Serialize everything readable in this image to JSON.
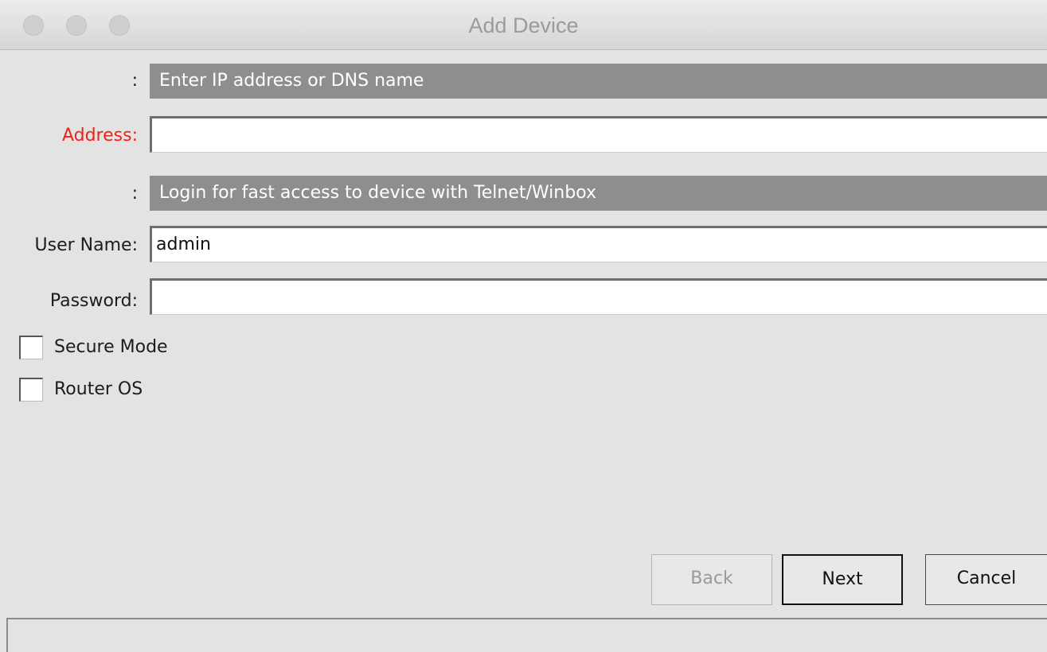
{
  "window": {
    "title": "Add Device"
  },
  "sections": {
    "address_banner_prefix": ":",
    "address_banner": "Enter IP address or DNS name",
    "login_banner_prefix": ":",
    "login_banner": "Login for fast access to device with Telnet/Winbox"
  },
  "fields": {
    "address_label": "Address:",
    "address_value": "",
    "username_label": "User Name:",
    "username_value": "admin",
    "password_label": "Password:",
    "password_value": ""
  },
  "checkboxes": {
    "secure_mode_label": "Secure Mode",
    "secure_mode_checked": false,
    "router_os_label": "Router OS",
    "router_os_checked": false
  },
  "buttons": {
    "back": "Back",
    "back_enabled": false,
    "next": "Next",
    "cancel": "Cancel"
  },
  "statusbar": {
    "text": ""
  },
  "colors": {
    "required_label": "#e8251b",
    "banner_bg": "#8e8e8e",
    "window_bg": "#e3e3e3"
  }
}
